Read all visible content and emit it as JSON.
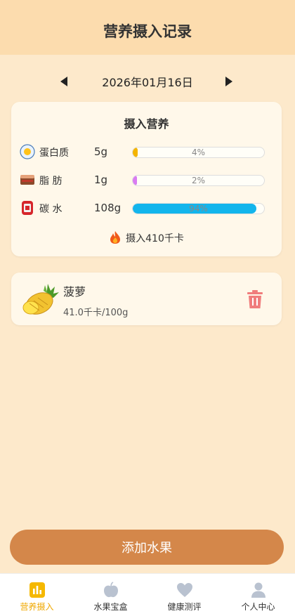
{
  "header": {
    "title": "营养摄入记录"
  },
  "date_nav": {
    "date": "2026年01月16日"
  },
  "nutrition": {
    "title": "摄入营养",
    "rows": [
      {
        "name": "蛋白质",
        "value": "5g",
        "percent": 4,
        "percent_label": "4%",
        "color": "#f4b400",
        "icon": "egg-icon"
      },
      {
        "name": "脂  肪",
        "value": "1g",
        "percent": 2,
        "percent_label": "2%",
        "color": "#d97bf1",
        "icon": "chocolate-icon"
      },
      {
        "name": "碳  水",
        "value": "108g",
        "percent": 94,
        "percent_label": "94%",
        "color": "#13b5ec",
        "icon": "can-icon"
      }
    ],
    "calories": "摄入410千卡"
  },
  "fruit_list": [
    {
      "name": "菠萝",
      "info": "41.0千卡/100g",
      "icon": "pineapple-icon"
    }
  ],
  "actions": {
    "add_label": "添加水果"
  },
  "tabbar": {
    "items": [
      {
        "label": "营养摄入",
        "icon": "chart-icon",
        "active": true
      },
      {
        "label": "水果宝盒",
        "icon": "apple-icon",
        "active": false
      },
      {
        "label": "健康测评",
        "icon": "heart-icon",
        "active": false
      },
      {
        "label": "个人中心",
        "icon": "person-icon",
        "active": false
      }
    ]
  }
}
